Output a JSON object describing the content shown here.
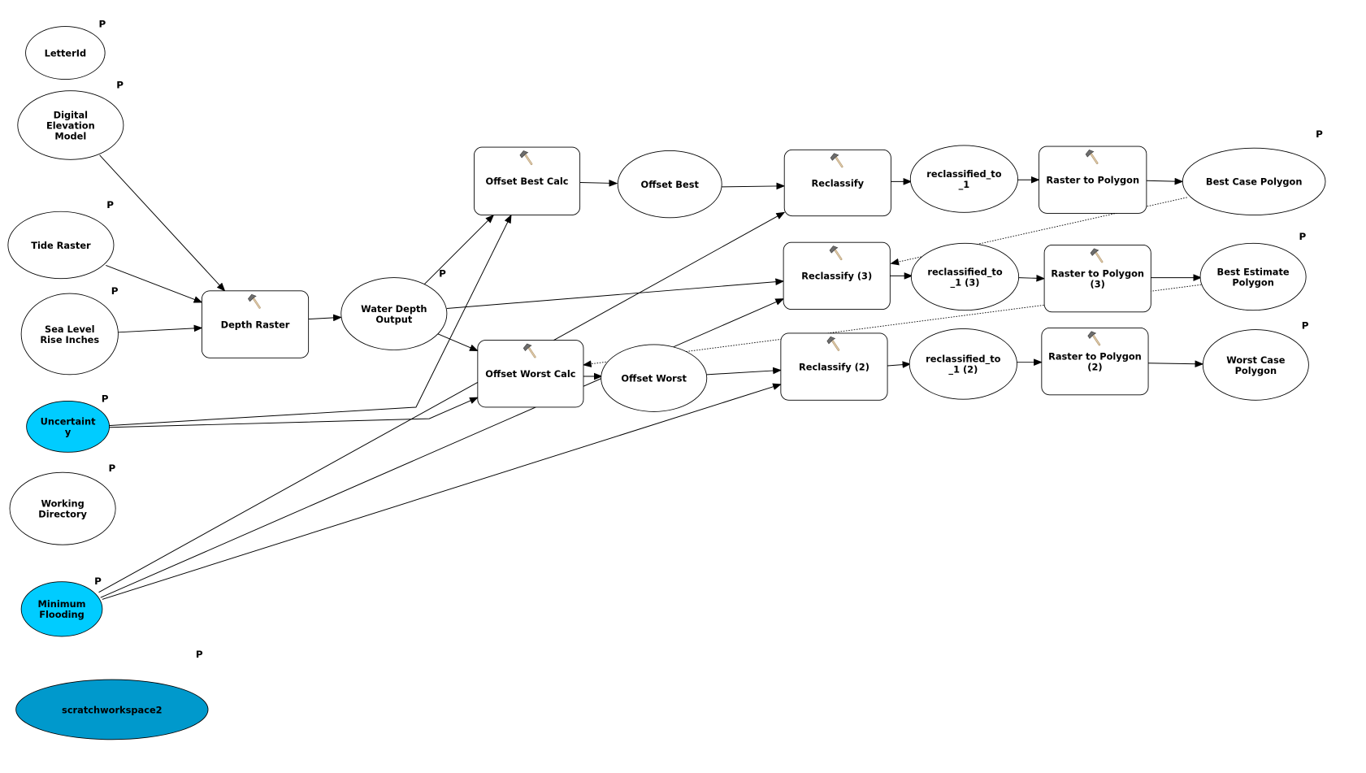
{
  "nodes": [
    {
      "id": "letterid",
      "label": [
        "LetterId"
      ],
      "kind": "variable",
      "param": true,
      "fill": "#ffffff"
    },
    {
      "id": "dem",
      "label": [
        "Digital",
        "Elevation",
        "Model"
      ],
      "kind": "variable",
      "param": true,
      "fill": "#ffffff"
    },
    {
      "id": "tide",
      "label": [
        "Tide Raster"
      ],
      "kind": "variable",
      "param": true,
      "fill": "#ffffff"
    },
    {
      "id": "slr",
      "label": [
        "Sea Level",
        "Rise Inches"
      ],
      "kind": "variable",
      "param": true,
      "fill": "#ffffff"
    },
    {
      "id": "uncertainty",
      "label": [
        "Uncertaint",
        "y"
      ],
      "kind": "variable",
      "param": true,
      "fill": "#00ccff"
    },
    {
      "id": "workdir",
      "label": [
        "Working",
        "Directory"
      ],
      "kind": "variable",
      "param": true,
      "fill": "#ffffff"
    },
    {
      "id": "minflood",
      "label": [
        "Minimum",
        "Flooding"
      ],
      "kind": "variable",
      "param": true,
      "fill": "#00ccff"
    },
    {
      "id": "scratch",
      "label": [
        "scratchworkspace2"
      ],
      "kind": "variable",
      "param": true,
      "fill": "#0099cc"
    },
    {
      "id": "depthRaster",
      "label": [
        "Depth Raster"
      ],
      "kind": "tool",
      "param": false
    },
    {
      "id": "waterDepth",
      "label": [
        "Water Depth",
        "Output"
      ],
      "kind": "variable",
      "param": true,
      "fill": "#ffffff"
    },
    {
      "id": "offsetBestCalc",
      "label": [
        "Offset Best Calc"
      ],
      "kind": "tool",
      "param": false
    },
    {
      "id": "offsetBest",
      "label": [
        "Offset Best"
      ],
      "kind": "variable",
      "param": false,
      "fill": "#ffffff"
    },
    {
      "id": "reclassify",
      "label": [
        "Reclassify"
      ],
      "kind": "tool",
      "param": false
    },
    {
      "id": "reclass1",
      "label": [
        "reclassified_to",
        "_1"
      ],
      "kind": "variable",
      "param": false,
      "fill": "#ffffff"
    },
    {
      "id": "rtp",
      "label": [
        "Raster to Polygon"
      ],
      "kind": "tool",
      "param": false
    },
    {
      "id": "bestCase",
      "label": [
        "Best Case Polygon"
      ],
      "kind": "variable",
      "param": true,
      "fill": "#ffffff"
    },
    {
      "id": "reclassify3",
      "label": [
        "Reclassify (3)"
      ],
      "kind": "tool",
      "param": false
    },
    {
      "id": "reclass13",
      "label": [
        "reclassified_to",
        "_1 (3)"
      ],
      "kind": "variable",
      "param": false,
      "fill": "#ffffff"
    },
    {
      "id": "rtp3",
      "label": [
        "Raster to Polygon",
        "(3)"
      ],
      "kind": "tool",
      "param": false
    },
    {
      "id": "bestEst",
      "label": [
        "Best Estimate",
        "Polygon"
      ],
      "kind": "variable",
      "param": true,
      "fill": "#ffffff"
    },
    {
      "id": "offsetWorstCalc",
      "label": [
        "Offset Worst Calc"
      ],
      "kind": "tool",
      "param": false
    },
    {
      "id": "offsetWorst",
      "label": [
        "Offset Worst"
      ],
      "kind": "variable",
      "param": false,
      "fill": "#ffffff"
    },
    {
      "id": "reclassify2",
      "label": [
        "Reclassify (2)"
      ],
      "kind": "tool",
      "param": false
    },
    {
      "id": "reclass12",
      "label": [
        "reclassified_to",
        "_1 (2)"
      ],
      "kind": "variable",
      "param": false,
      "fill": "#ffffff"
    },
    {
      "id": "rtp2",
      "label": [
        "Raster to Polygon",
        "(2)"
      ],
      "kind": "tool",
      "param": false
    },
    {
      "id": "worstCase",
      "label": [
        "Worst Case",
        "Polygon"
      ],
      "kind": "variable",
      "param": true,
      "fill": "#ffffff"
    }
  ],
  "param_marker": "P",
  "tool_icon": "hammer-icon",
  "edges": [
    {
      "from": "dem",
      "to": "depthRaster",
      "style": "solid"
    },
    {
      "from": "tide",
      "to": "depthRaster",
      "style": "solid"
    },
    {
      "from": "slr",
      "to": "depthRaster",
      "style": "solid"
    },
    {
      "from": "depthRaster",
      "to": "waterDepth",
      "style": "solid"
    },
    {
      "from": "waterDepth",
      "to": "offsetBestCalc",
      "style": "solid"
    },
    {
      "from": "waterDepth",
      "to": "reclassify3",
      "style": "solid"
    },
    {
      "from": "waterDepth",
      "to": "offsetWorstCalc",
      "style": "solid"
    },
    {
      "from": "uncertainty",
      "to": "offsetBestCalc",
      "style": "solid"
    },
    {
      "from": "uncertainty",
      "to": "offsetWorstCalc",
      "style": "solid"
    },
    {
      "from": "minflood",
      "to": "reclassify",
      "style": "solid"
    },
    {
      "from": "minflood",
      "to": "reclassify3",
      "style": "solid"
    },
    {
      "from": "minflood",
      "to": "reclassify2",
      "style": "solid"
    },
    {
      "from": "offsetBestCalc",
      "to": "offsetBest",
      "style": "solid"
    },
    {
      "from": "offsetBest",
      "to": "reclassify",
      "style": "solid"
    },
    {
      "from": "offsetWorstCalc",
      "to": "offsetWorst",
      "style": "solid"
    },
    {
      "from": "offsetWorst",
      "to": "reclassify2",
      "style": "solid"
    },
    {
      "from": "reclassify",
      "to": "reclass1",
      "style": "solid"
    },
    {
      "from": "reclass1",
      "to": "rtp",
      "style": "solid"
    },
    {
      "from": "rtp",
      "to": "bestCase",
      "style": "solid"
    },
    {
      "from": "reclassify3",
      "to": "reclass13",
      "style": "solid"
    },
    {
      "from": "reclass13",
      "to": "rtp3",
      "style": "solid"
    },
    {
      "from": "rtp3",
      "to": "bestEst",
      "style": "solid"
    },
    {
      "from": "reclassify2",
      "to": "reclass12",
      "style": "solid"
    },
    {
      "from": "reclass12",
      "to": "rtp2",
      "style": "solid"
    },
    {
      "from": "rtp2",
      "to": "worstCase",
      "style": "solid"
    },
    {
      "from": "bestCase",
      "to": "reclassify3",
      "style": "dotted"
    },
    {
      "from": "bestEst",
      "to": "offsetWorstCalc",
      "style": "dotted"
    }
  ]
}
